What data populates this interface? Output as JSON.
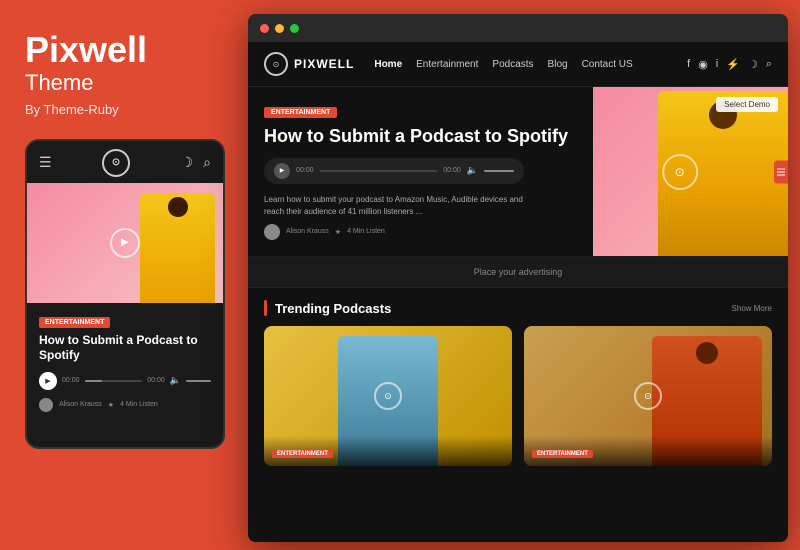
{
  "brand": {
    "title": "Pixwell",
    "subtitle": "Theme",
    "by": "By Theme-Ruby"
  },
  "mobile": {
    "ent_tag": "ENTERTAINMENT",
    "article_title": "How to Submit a Podcast to Spotify",
    "play_time_start": "00:00",
    "play_time_end": "00:00",
    "author_name": "Alison Krauss",
    "read_time": "4 Min Listen"
  },
  "site": {
    "logo_text": "PIXWELL",
    "nav": {
      "links": [
        "Home",
        "Entertainment",
        "Podcasts",
        "Blog",
        "Contact US"
      ]
    },
    "hero": {
      "ent_tag": "ENTERTAINMENT",
      "title": "How to Submit a Podcast to Spotify",
      "description": "Learn how to submit your podcast to Amazon Music, Audible devices and reach their audience of 41 million listeners ...",
      "author": "Alison Krauss",
      "read_time": "4 Min Listen",
      "time_start": "00:00",
      "time_end": "00:00",
      "select_demo": "Select Demo"
    },
    "ad_banner": "Place your advertising",
    "trending": {
      "title": "Trending Podcasts",
      "show_more": "Show More"
    },
    "sidebar_toggle_label": "settings"
  }
}
